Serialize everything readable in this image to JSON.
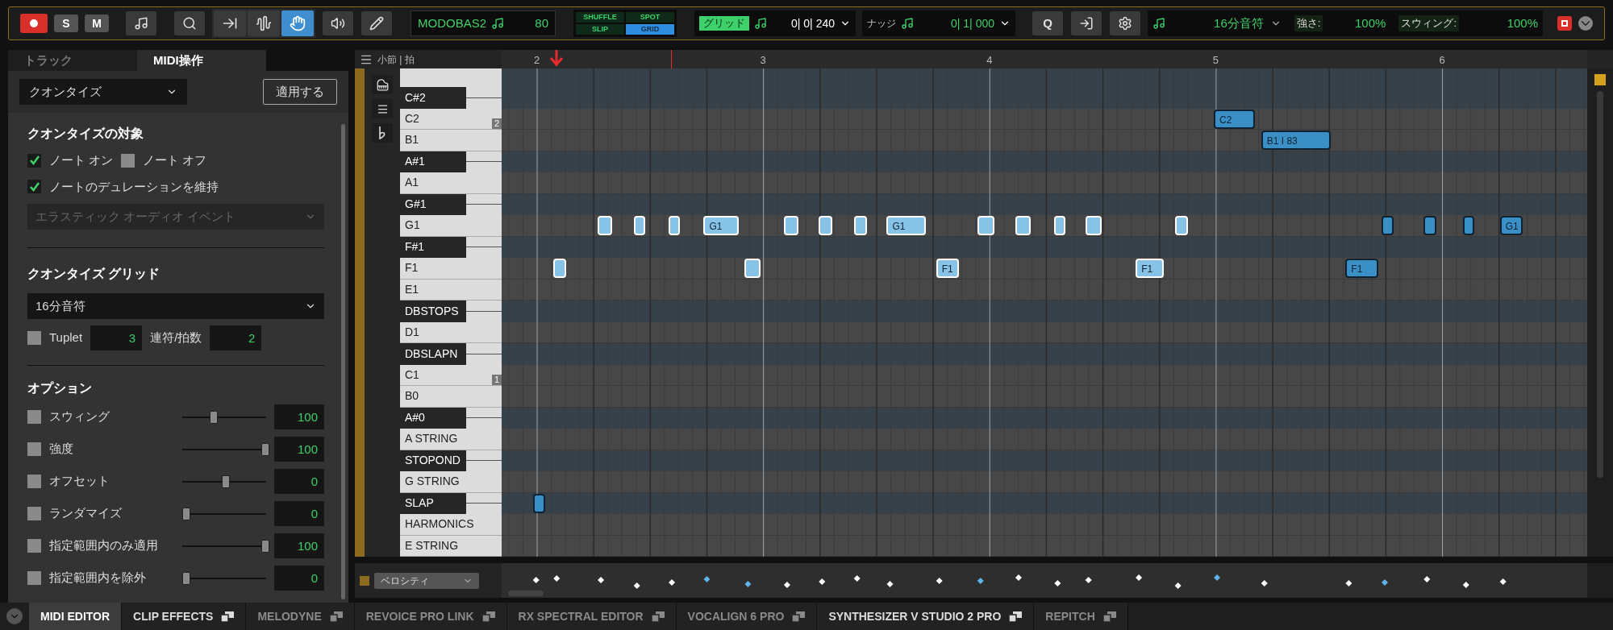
{
  "toolbar": {
    "record": {
      "on": true
    },
    "solo_label": "S",
    "mute_label": "M",
    "tools": [
      {
        "kind": "import",
        "selected": false
      },
      {
        "kind": "wave",
        "selected": false
      },
      {
        "kind": "hand",
        "selected": true
      }
    ],
    "track_name": "MODOBAS2",
    "tempo_value": "80",
    "edit_modes": [
      {
        "label": "SHUFFLE",
        "selected": false
      },
      {
        "label": "SPOT",
        "selected": false
      },
      {
        "label": "SLIP",
        "selected": false
      },
      {
        "label": "GRID",
        "selected": true
      }
    ],
    "grid_label": "グリッド",
    "grid_value": "0| 0| 240",
    "nudge_label": "ナッジ",
    "nudge_value": "0| 1| 000",
    "q_label": "Q",
    "quantize_value": "16分音符",
    "strength_label": "強さ:",
    "strength_value": "100%",
    "swing_label": "スウィング:",
    "swing_value": "100%"
  },
  "side_panel": {
    "tabs": [
      {
        "label": "トラック",
        "selected": false
      },
      {
        "label": "MIDI操作",
        "selected": true
      }
    ],
    "operation": "クオンタイズ",
    "apply_button": "適用する",
    "target_heading": "クオンタイズの対象",
    "note_on": {
      "label": "ノート オン",
      "checked": true
    },
    "note_off": {
      "label": "ノート オフ",
      "checked": false
    },
    "keep_duration": {
      "label": "ノートのデュレーションを維持",
      "checked": true
    },
    "elastic": {
      "value": "エラスティック オーディオ イベント",
      "disabled": true
    },
    "grid_heading": "クオンタイズ グリッド",
    "grid_value": "16分音符",
    "tuplet": {
      "label": "Tuplet",
      "checked": false,
      "value": "3"
    },
    "tuplet_ratio_label": "連符/拍数",
    "tuplet_ratio_value": "2",
    "options_heading": "オプション",
    "options": [
      {
        "label": "スウィング",
        "checked": false,
        "level": 0.35,
        "value": "100"
      },
      {
        "label": "強度",
        "checked": false,
        "level": 1,
        "value": "100"
      },
      {
        "label": "オフセット",
        "checked": false,
        "level": 0.5,
        "value": "0"
      },
      {
        "label": "ランダマイズ",
        "checked": false,
        "level": 0,
        "value": "0"
      },
      {
        "label": "指定範囲内のみ適用",
        "checked": false,
        "level": 1,
        "value": "100"
      },
      {
        "label": "指定範囲内を除外",
        "checked": false,
        "level": 0,
        "value": "0"
      }
    ]
  },
  "editor": {
    "ruler_label": "小節 | 拍",
    "bars": [
      "2",
      "3",
      "4",
      "5",
      "6"
    ],
    "keys": [
      {
        "label": "C#2",
        "kind": "black"
      },
      {
        "label": "C2",
        "kind": "white",
        "octave": "2"
      },
      {
        "label": "B1",
        "kind": "white"
      },
      {
        "label": "A#1",
        "kind": "black"
      },
      {
        "label": "A1",
        "kind": "white"
      },
      {
        "label": "G#1",
        "kind": "black"
      },
      {
        "label": "G1",
        "kind": "white"
      },
      {
        "label": "F#1",
        "kind": "black"
      },
      {
        "label": "F1",
        "kind": "white"
      },
      {
        "label": "E1",
        "kind": "white"
      },
      {
        "label": "DBSTOPS",
        "kind": "black"
      },
      {
        "label": "D1",
        "kind": "white"
      },
      {
        "label": "DBSLAPN",
        "kind": "black"
      },
      {
        "label": "C1",
        "kind": "white",
        "octave": "1"
      },
      {
        "label": "B0",
        "kind": "white"
      },
      {
        "label": "A#0",
        "kind": "black"
      },
      {
        "label": "A STRING",
        "kind": "white"
      },
      {
        "label": "STOPOND",
        "kind": "black"
      },
      {
        "label": "G STRING",
        "kind": "white"
      },
      {
        "label": "SLAP",
        "kind": "black"
      },
      {
        "label": "HARMONICS",
        "kind": "white"
      },
      {
        "label": "E STRING",
        "kind": "white"
      }
    ],
    "notes": [
      {
        "label": "C2",
        "selected": false
      },
      {
        "label": "B1 I 83",
        "selected": false
      },
      {
        "selected": true
      },
      {
        "selected": true
      },
      {
        "selected": true
      },
      {
        "label": "G1",
        "selected": true
      },
      {
        "selected": true
      },
      {
        "selected": true
      },
      {
        "selected": true
      },
      {
        "label": "G1",
        "selected": true
      },
      {
        "selected": true
      },
      {
        "selected": true
      },
      {
        "selected": true
      },
      {
        "selected": true
      },
      {
        "selected": true
      },
      {
        "selected": false
      },
      {
        "selected": false
      },
      {
        "selected": false
      },
      {
        "label": "G1",
        "selected": false
      },
      {
        "selected": true
      },
      {
        "selected": true
      },
      {
        "label": "F1",
        "selected": true
      },
      {
        "label": "F1",
        "selected": true
      },
      {
        "label": "F1",
        "selected": false
      },
      {
        "selected": false
      }
    ],
    "lane_label": "ベロシティ"
  },
  "bottom_tabs": [
    {
      "label": "MIDI EDITOR",
      "selected": true,
      "dimmed": false,
      "float": false
    },
    {
      "label": "CLIP EFFECTS",
      "selected": false,
      "dimmed": false,
      "float": true
    },
    {
      "label": "MELODYNE",
      "selected": false,
      "dimmed": true,
      "float": true
    },
    {
      "label": "REVOICE PRO LINK",
      "selected": false,
      "dimmed": true,
      "float": true
    },
    {
      "label": "RX SPECTRAL EDITOR",
      "selected": false,
      "dimmed": true,
      "float": true
    },
    {
      "label": "VOCALIGN 6 PRO",
      "selected": false,
      "dimmed": true,
      "float": true
    },
    {
      "label": "SYNTHESIZER V STUDIO 2 PRO",
      "selected": false,
      "dimmed": false,
      "float": true
    },
    {
      "label": "REPITCH",
      "selected": false,
      "dimmed": true,
      "float": true
    }
  ]
}
